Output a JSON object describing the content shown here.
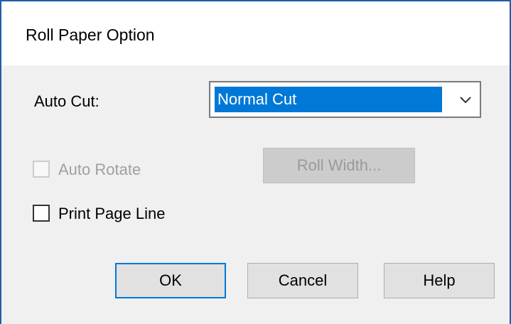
{
  "dialog": {
    "title": "Roll Paper Option",
    "auto_cut": {
      "label": "Auto Cut:",
      "selected": "Normal Cut",
      "arrow_icon": "chevron-down-icon"
    },
    "auto_rotate": {
      "label": "Auto Rotate",
      "checked": false,
      "enabled": false
    },
    "roll_width_button": "Roll Width...",
    "print_page_line": {
      "label": "Print Page Line",
      "checked": false,
      "enabled": true
    },
    "buttons": {
      "ok": "OK",
      "cancel": "Cancel",
      "help": "Help"
    }
  },
  "colors": {
    "accent": "#0078d7",
    "frame": "#1f5fa8",
    "dialog_bg": "#f0f0f0",
    "disabled_text": "#a0a0a0"
  }
}
